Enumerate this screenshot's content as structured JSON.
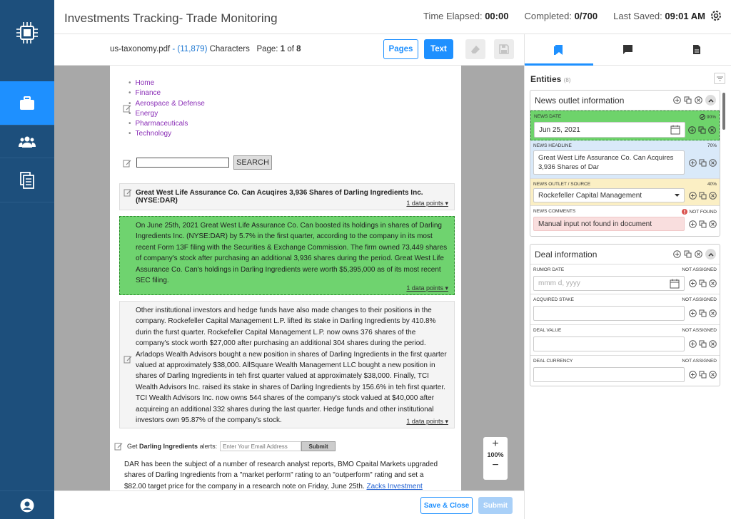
{
  "header": {
    "title": "Investments Tracking- Trade Monitoring",
    "time_label": "Time Elapsed:",
    "time_value": "00:00",
    "completed_label": "Completed:",
    "completed_value": "0/700",
    "saved_label": "Last Saved:",
    "saved_value": "09:01 AM"
  },
  "doc": {
    "filename": "us-taxonomy.pdf",
    "separator": "-",
    "char_count": "(11,879)",
    "char_label": "Characters",
    "page_label": "Page:",
    "page_current": "1",
    "page_of": "of",
    "page_total": "8",
    "pages_btn": "Pages",
    "text_btn": "Text"
  },
  "page": {
    "links": [
      "Home",
      "Finance",
      "Aerospace & Defense",
      "Energy",
      "Pharmaceuticals",
      "Technology"
    ],
    "search_btn": "SEARCH",
    "headline": "Great West Life Assurance Co. Can Acuqires 3,936 Shares of Darling Ingredients Inc. (NYSE:DAR)",
    "data_points": "1 data points",
    "para1": "On June 25th, 2021 Great West Life Assurance Co. Can boosted its holdings in shares of Darling Ingredients Inc. (NYSE:DAR) by 5.7% in the first quarter, according to the company in its most recent Form 13F filing with the Securities & Exchange Commission. The firm owned 73,449 shares of company's stock after purchasing an additional 3,936 shares during the period. Great West Life Assurance Co. Can's holdings in Darling Ingredients were worth $5,395,000 as of its most recent SEC filing.",
    "para2": "Other institutional investors and hedge funds have also made changes to their positions in the company. Rockefeller Capital Management L.P. lifted its stake in Darling Ingredients by 410.8% durin the furst quarter. Rockefeller Capital Management L.P. now owns 376 shares of the company's stock worth $27,000 after purchasing an additional 304 shares during the period. Arladops Wealth Advisors bought a new position in shares of Darling Ingredients in the first quarter valued at approximately $38,000. AllSquare Wealth Management LLC bought a new position in shares of Darling Ingredients in teh first quarter valued at approximately $38,000. Finally, TCI Wealth Advisors Inc. raised its stake in shares of Darling Ingredients by 156.6% in teh first quarter. TCI Wealth Advisors Inc. now owns 544 shares of the company's stock valued at $40,000 after acquireing an additional 332 shares during the last quarter. Hedge funds and other institutional investors own 95.87% of the company's stock.",
    "alert_pre": "Get",
    "alert_bold": "Darling Ingredients",
    "alert_post": "alerts:",
    "email_placeholder": "Enter Your Email Address",
    "alert_submit": "Submit",
    "para3": "DAR has been the subject of a number of research analyst reports, BMO Cpaital Markets upgraded shares of Darling Ingredients from a \"market perform\" rating to an \"outperform\" rating and set a $82.00 target price for the company in a research note on Friday, June 25th.",
    "para3_link": "Zacks Investment"
  },
  "zoom": {
    "plus": "+",
    "pct": "100%",
    "minus": "−"
  },
  "bottom": {
    "save_close": "Save & Close",
    "submit": "Submit"
  },
  "entities": {
    "title": "Entities",
    "count": "(8)",
    "cards": [
      {
        "title": "News outlet information",
        "fields": [
          {
            "label": "News Date",
            "status": "90%",
            "value": "Jun 25, 2021"
          },
          {
            "label": "News Headline",
            "status": "70%",
            "value": "Great West Life Assurance Co. Can Acquires 3,936 Shares of Dar"
          },
          {
            "label": "News Outlet / Source",
            "status": "40%",
            "value": "Rockefeller Capital Management"
          },
          {
            "label": "News Comments",
            "status": "NOT FOUND",
            "value": "Manual input not found in document"
          }
        ]
      },
      {
        "title": "Deal information",
        "fields": [
          {
            "label": "Rumor Date",
            "status": "NOT ASSIGNED",
            "placeholder": "mmm d, yyyy"
          },
          {
            "label": "Acquired Stake",
            "status": "NOT ASSIGNED"
          },
          {
            "label": "Deal Value",
            "status": "NOT ASSIGNED"
          },
          {
            "label": "Deal Currency",
            "status": "NOT ASSIGNED"
          }
        ]
      }
    ]
  },
  "colors": {
    "nav_bg": "#1d4f7c",
    "accent": "#1e90ff",
    "green_field": "#6ed36b",
    "blue_field": "#d9e9f9",
    "yellow_field": "#fbefc4",
    "red_field": "#f9dede"
  }
}
